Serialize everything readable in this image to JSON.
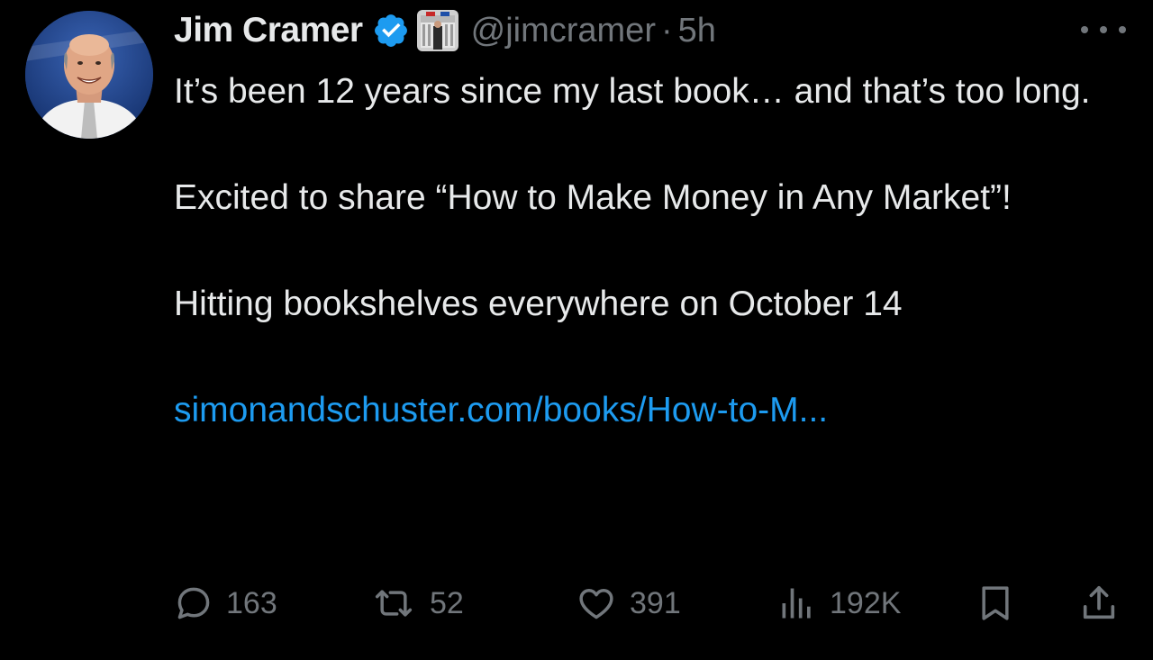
{
  "author": {
    "display_name": "Jim Cramer",
    "handle": "@jimcramer",
    "separator": "·",
    "timestamp": "5h",
    "verified_color": "#1d9bf0"
  },
  "tweet": {
    "paragraphs": [
      "It’s been 12 years since my last book… and that’s too long.",
      "Excited to share “How to Make Money in Any Market”!",
      "Hitting bookshelves everywhere on October 14"
    ],
    "link_text": "simonandschuster.com/books/How-to-M..."
  },
  "actions": {
    "replies": "163",
    "reposts": "52",
    "likes": "391",
    "views": "192K"
  },
  "colors": {
    "background": "#000000",
    "text": "#e7e9ea",
    "muted": "#71767b",
    "link": "#1d9bf0"
  },
  "icons": [
    "more-icon",
    "verified-badge-icon",
    "reply-icon",
    "repost-icon",
    "like-icon",
    "views-icon",
    "bookmark-icon",
    "share-icon"
  ]
}
